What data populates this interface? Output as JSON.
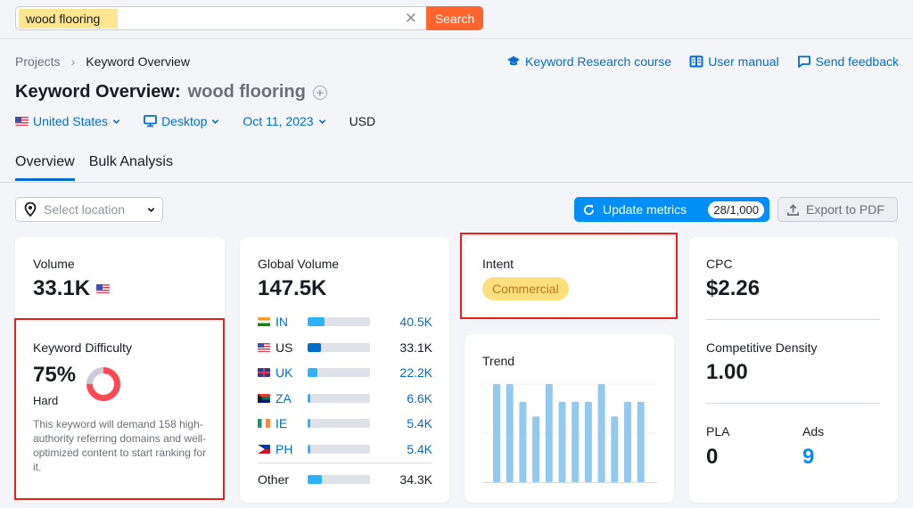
{
  "search": {
    "value": "wood flooring",
    "clear_icon": "close-icon",
    "button_label": "Search"
  },
  "breadcrumb": {
    "items": [
      "Projects",
      "Keyword Overview"
    ]
  },
  "top_links": [
    {
      "label": "Keyword Research course",
      "icon": "graduation-cap-icon"
    },
    {
      "label": "User manual",
      "icon": "book-icon"
    },
    {
      "label": "Send feedback",
      "icon": "chat-bubble-icon"
    }
  ],
  "header": {
    "title": "Keyword Overview:",
    "keyword": "wood flooring",
    "add_icon": "plus-circle-icon"
  },
  "filters": {
    "country": "United States",
    "device": "Desktop",
    "date": "Oct 11, 2023",
    "currency": "USD"
  },
  "tabs": [
    {
      "label": "Overview",
      "active": true
    },
    {
      "label": "Bulk Analysis",
      "active": false
    }
  ],
  "toolbar": {
    "location_placeholder": "Select location",
    "update_label": "Update metrics",
    "update_count": "28/1,000",
    "export_label": "Export to PDF"
  },
  "volume": {
    "label": "Volume",
    "value": "33.1K"
  },
  "keyword_difficulty": {
    "label": "Keyword Difficulty",
    "value": "75%",
    "percent": 75,
    "level": "Hard",
    "description": "This keyword will demand 158 high-authority referring domains and well-optimized content to start ranking for it.",
    "color": "#ff4953"
  },
  "global_volume": {
    "label": "Global Volume",
    "value": "147.5K",
    "countries": [
      {
        "code": "IN",
        "value": "40.5K",
        "share": 0.27,
        "link": true,
        "flag": "in"
      },
      {
        "code": "US",
        "value": "33.1K",
        "share": 0.22,
        "link": false,
        "flag": "us"
      },
      {
        "code": "UK",
        "value": "22.2K",
        "share": 0.15,
        "link": true,
        "flag": "uk"
      },
      {
        "code": "ZA",
        "value": "6.6K",
        "share": 0.04,
        "link": true,
        "flag": "za"
      },
      {
        "code": "IE",
        "value": "5.4K",
        "share": 0.04,
        "link": true,
        "flag": "ie"
      },
      {
        "code": "PH",
        "value": "5.4K",
        "share": 0.04,
        "link": true,
        "flag": "ph"
      }
    ],
    "other": {
      "label": "Other",
      "value": "34.3K",
      "share": 0.23
    }
  },
  "intent": {
    "label": "Intent",
    "value": "Commercial"
  },
  "trend": {
    "label": "Trend",
    "relative_values": [
      1,
      1,
      0.82,
      0.67,
      1,
      0.82,
      0.82,
      0.82,
      1,
      0.67,
      0.82,
      0.82
    ],
    "bar_color": "#93c9ef"
  },
  "cpc": {
    "label": "CPC",
    "value": "$2.26"
  },
  "competitive_density": {
    "label": "Competitive Density",
    "value": "1.00"
  },
  "pla": {
    "label": "PLA",
    "value": "0"
  },
  "ads": {
    "label": "Ads",
    "value": "9"
  }
}
